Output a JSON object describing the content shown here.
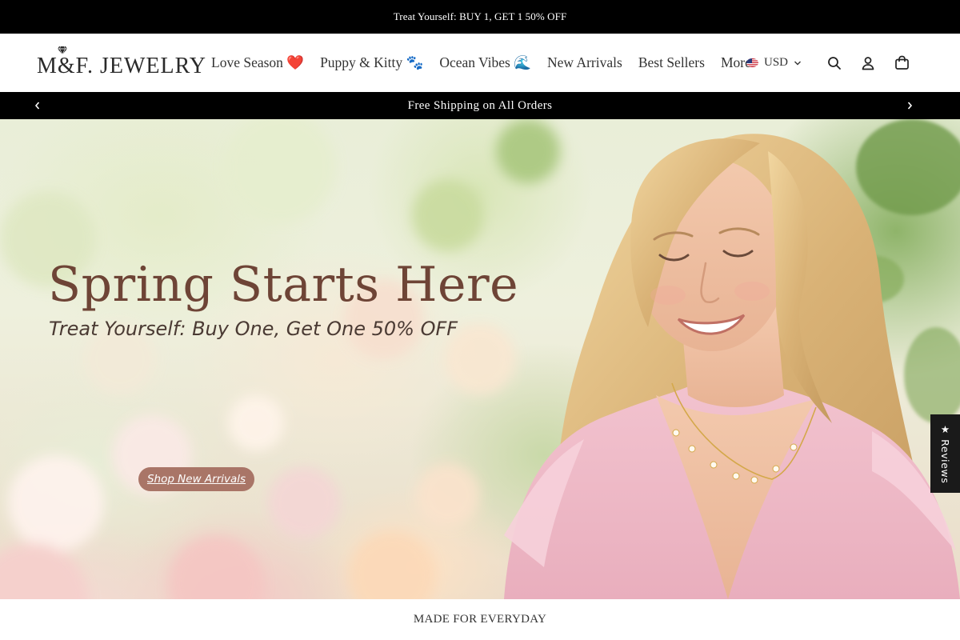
{
  "promo_bar": {
    "text": "Treat Yourself: BUY 1, GET 1 50% OFF"
  },
  "header": {
    "logo_text": "M&F. JEWELRY",
    "nav": [
      {
        "label": "Love Season ❤️"
      },
      {
        "label": "Puppy & Kitty 🐾"
      },
      {
        "label": "Ocean Vibes 🌊"
      },
      {
        "label": "New Arrivals"
      },
      {
        "label": "Best Sellers"
      },
      {
        "label": "More"
      }
    ],
    "currency": {
      "label": "USD",
      "icon": "us-flag-icon"
    },
    "icons": [
      "search-icon",
      "account-icon",
      "cart-icon"
    ]
  },
  "announcement": {
    "text": "Free Shipping on All Orders"
  },
  "hero": {
    "title": "Spring Starts Here",
    "subtitle": "Treat Yourself: Buy One, Get One 50% OFF",
    "cta_label": "Shop New Arrivals",
    "reviews_label": "★ Reviews"
  },
  "section": {
    "heading": "MADE FOR EVERYDAY"
  },
  "colors": {
    "bar_bg": "#000000",
    "title_color": "#6e4436",
    "cta_bg": "#a97567"
  }
}
